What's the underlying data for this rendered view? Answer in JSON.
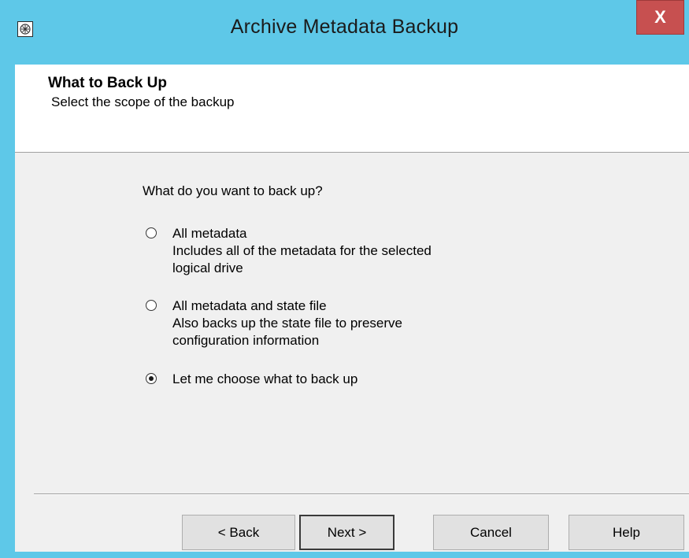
{
  "window": {
    "title": "Archive Metadata Backup",
    "close_label": "X"
  },
  "header": {
    "title": "What to Back Up",
    "subtitle": "Select the scope of the backup"
  },
  "body": {
    "question": "What do you want to back up?",
    "options": [
      {
        "label": "All metadata",
        "description_line1": "Includes all of the metadata for the selected",
        "description_line2": "logical drive",
        "selected": false
      },
      {
        "label": "All metadata and state file",
        "description_line1": "Also backs up the state file to preserve",
        "description_line2": "configuration information",
        "selected": false
      },
      {
        "label": "Let me choose what to back up",
        "selected": true
      }
    ]
  },
  "buttons": {
    "back": "< Back",
    "next": "Next >",
    "cancel": "Cancel",
    "help": "Help"
  },
  "icons": {
    "app": "app-icon",
    "close": "close-icon"
  },
  "colors": {
    "titlebar": "#5ec8e8",
    "close_button": "#c75050",
    "dialog_background": "#f0f0f0"
  }
}
